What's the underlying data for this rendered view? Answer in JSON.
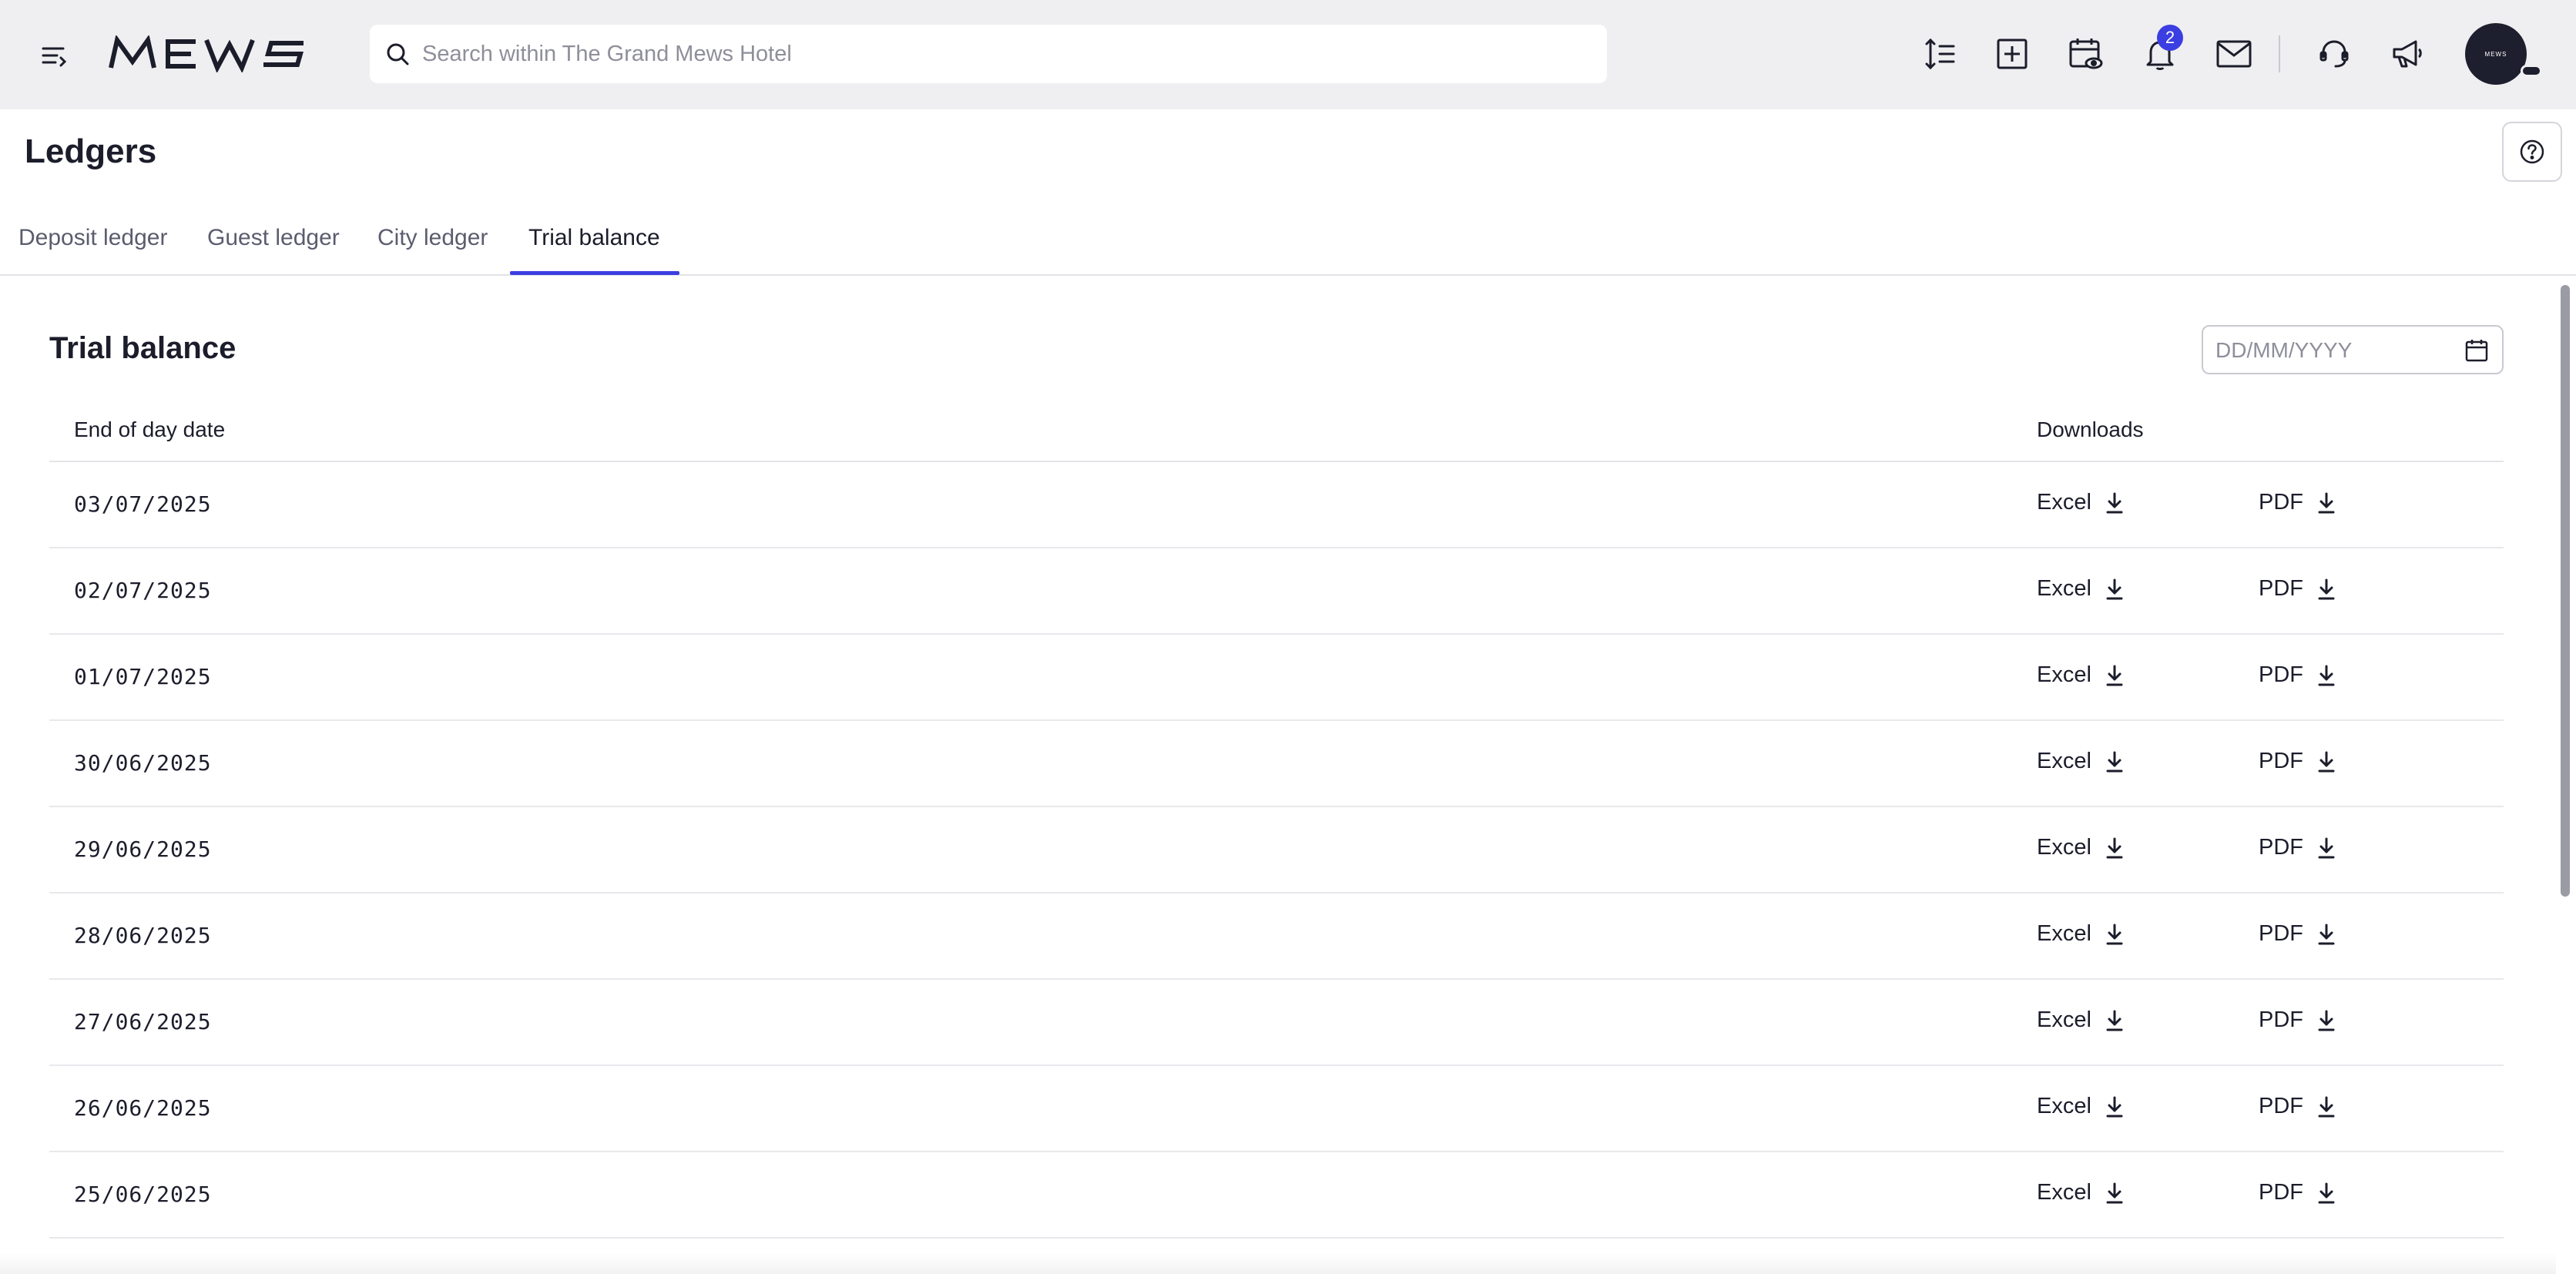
{
  "header": {
    "logo_text": "MEWS",
    "search": {
      "placeholder": "Search within The Grand Mews Hotel",
      "value": ""
    },
    "icons": [
      "menu-icon",
      "density-icon",
      "add-icon",
      "calendar-view-icon",
      "bell-icon",
      "mail-icon",
      "support-icon",
      "megaphone-icon"
    ],
    "notification_count": "2",
    "avatar_text": "MEWS"
  },
  "page": {
    "title": "Ledgers",
    "help_icon": "question-icon"
  },
  "tabs": [
    {
      "label": "Deposit ledger",
      "active": false
    },
    {
      "label": "Guest ledger",
      "active": false
    },
    {
      "label": "City ledger",
      "active": false
    },
    {
      "label": "Trial balance",
      "active": true
    }
  ],
  "trial_balance": {
    "title": "Trial balance",
    "date_filter": {
      "placeholder": "DD/MM/YYYY",
      "value": ""
    },
    "columns": {
      "date": "End of day date",
      "downloads": "Downloads"
    },
    "download_labels": {
      "excel": "Excel",
      "pdf": "PDF"
    },
    "rows": [
      {
        "date": "03/07/2025"
      },
      {
        "date": "02/07/2025"
      },
      {
        "date": "01/07/2025"
      },
      {
        "date": "30/06/2025"
      },
      {
        "date": "29/06/2025"
      },
      {
        "date": "28/06/2025"
      },
      {
        "date": "27/06/2025"
      },
      {
        "date": "26/06/2025"
      },
      {
        "date": "25/06/2025"
      }
    ]
  },
  "colors": {
    "accent": "#3b3ee0",
    "topbar": "#efeff1",
    "text": "#1c1d2b",
    "muted_text": "#5b5c6e"
  }
}
